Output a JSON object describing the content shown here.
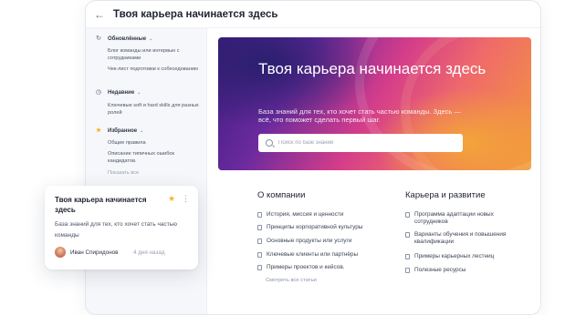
{
  "window": {
    "title": "Твоя карьера начинается здесь"
  },
  "sidebar": {
    "updated": {
      "label": "Обновлённые",
      "items": [
        "Блог команды или интервью с сотрудниками",
        "Чек-лист подготовки к собеседованию"
      ]
    },
    "recent": {
      "label": "Недавние",
      "items": [
        "Ключевые soft и hard skills для разных ролей"
      ]
    },
    "favorites": {
      "label": "Избранное",
      "items": [
        "Общие правила",
        "Описание типичных ошибок кандидатов."
      ]
    },
    "show_all": "Показать все"
  },
  "hero": {
    "title": "Твоя карьера начинается здесь",
    "subtitle": "База знаний для тех, кто хочет стать частью команды. Здесь — всё, что поможет сделать первый шаг.",
    "search_placeholder": "Поиск по базе знаний"
  },
  "about": {
    "title": "О компании",
    "links": [
      "История, миссия и ценности",
      "Принципы корпоративной культуры",
      "Основные продукты или услуги",
      "Ключевые клиенты или партнёры",
      "Примеры проектов и кейсов."
    ],
    "more": "Смотреть все статьи"
  },
  "career": {
    "title": "Карьера и развитие",
    "links": [
      "Программа адаптации новых сотрудников",
      "Варианты обучения и повышения квалификации",
      "Примеры карьерных лестниц",
      "Полезные ресурсы"
    ]
  },
  "card": {
    "title": "Твоя карьера начинается здесь",
    "description": "База знаний для тех, кто хочет стать частью команды",
    "author": "Иван Спиридонов",
    "time": "4 дня назад"
  }
}
